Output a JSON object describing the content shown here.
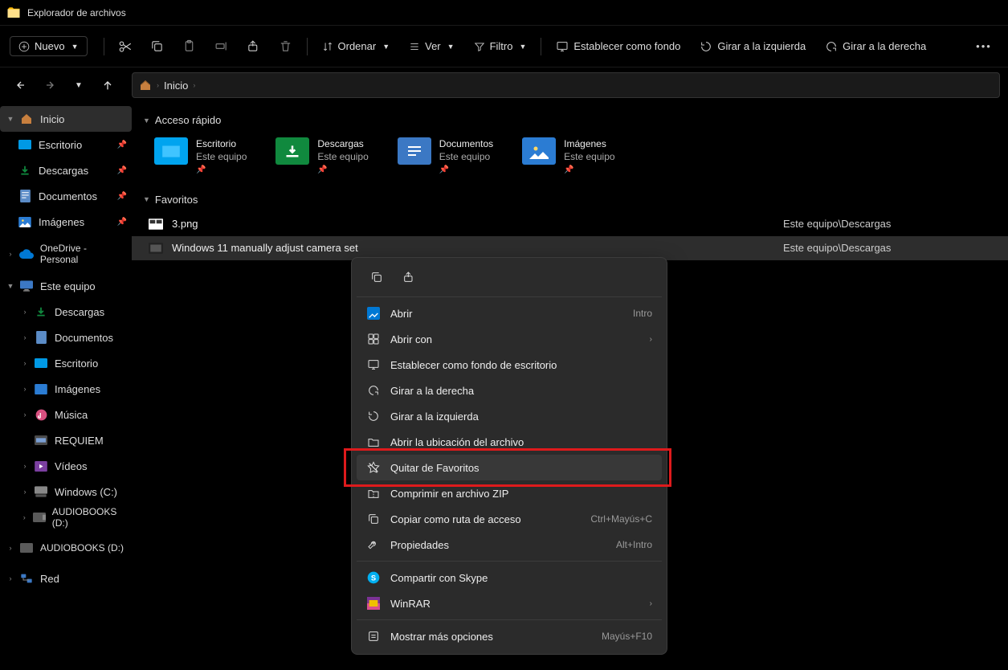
{
  "title": "Explorador de archivos",
  "toolbar": {
    "new": "Nuevo",
    "sort": "Ordenar",
    "view": "Ver",
    "filter": "Filtro",
    "set_bg": "Establecer como fondo",
    "rotate_left": "Girar a la izquierda",
    "rotate_right": "Girar a la derecha"
  },
  "breadcrumb": {
    "item": "Inicio"
  },
  "sidebar": {
    "home": "Inicio",
    "desktop": "Escritorio",
    "downloads": "Descargas",
    "documents": "Documentos",
    "pictures": "Imágenes",
    "onedrive": "OneDrive - Personal",
    "thispc": "Este equipo",
    "s_downloads": "Descargas",
    "s_documents": "Documentos",
    "s_desktop": "Escritorio",
    "s_pictures": "Imágenes",
    "s_music": "Música",
    "s_requiem": "REQUIEM",
    "s_videos": "Vídeos",
    "s_windows_c": "Windows (C:)",
    "s_audiobooks1": "AUDIOBOOKS (D:)",
    "s_audiobooks2": "AUDIOBOOKS (D:)",
    "network": "Red"
  },
  "sections": {
    "quickaccess": "Acceso rápido",
    "favorites": "Favoritos"
  },
  "quickaccess": [
    {
      "name": "Escritorio",
      "loc": "Este equipo",
      "color": "#00a4ef"
    },
    {
      "name": "Descargas",
      "loc": "Este equipo",
      "color": "#10893e"
    },
    {
      "name": "Documentos",
      "loc": "Este equipo",
      "color": "#3b78c4"
    },
    {
      "name": "Imágenes",
      "loc": "Este equipo",
      "color": "#2b7cd3"
    }
  ],
  "favorites": [
    {
      "name": "3.png",
      "path": "Este equipo\\Descargas"
    },
    {
      "name": "Windows 11 manually adjust camera set",
      "path": "Este equipo\\Descargas"
    }
  ],
  "contextmenu": {
    "open": "Abrir",
    "open_sc": "Intro",
    "openwith": "Abrir con",
    "set_bg": "Establecer como fondo de escritorio",
    "rotate_right": "Girar a la derecha",
    "rotate_left": "Girar a la izquierda",
    "open_loc": "Abrir la ubicación del archivo",
    "remove_fav": "Quitar de Favoritos",
    "compress": "Comprimir en archivo ZIP",
    "copy_path": "Copiar como ruta de acceso",
    "copy_path_sc": "Ctrl+Mayús+C",
    "properties": "Propiedades",
    "properties_sc": "Alt+Intro",
    "share_skype": "Compartir con Skype",
    "winrar": "WinRAR",
    "more": "Mostrar más opciones",
    "more_sc": "Mayús+F10"
  }
}
